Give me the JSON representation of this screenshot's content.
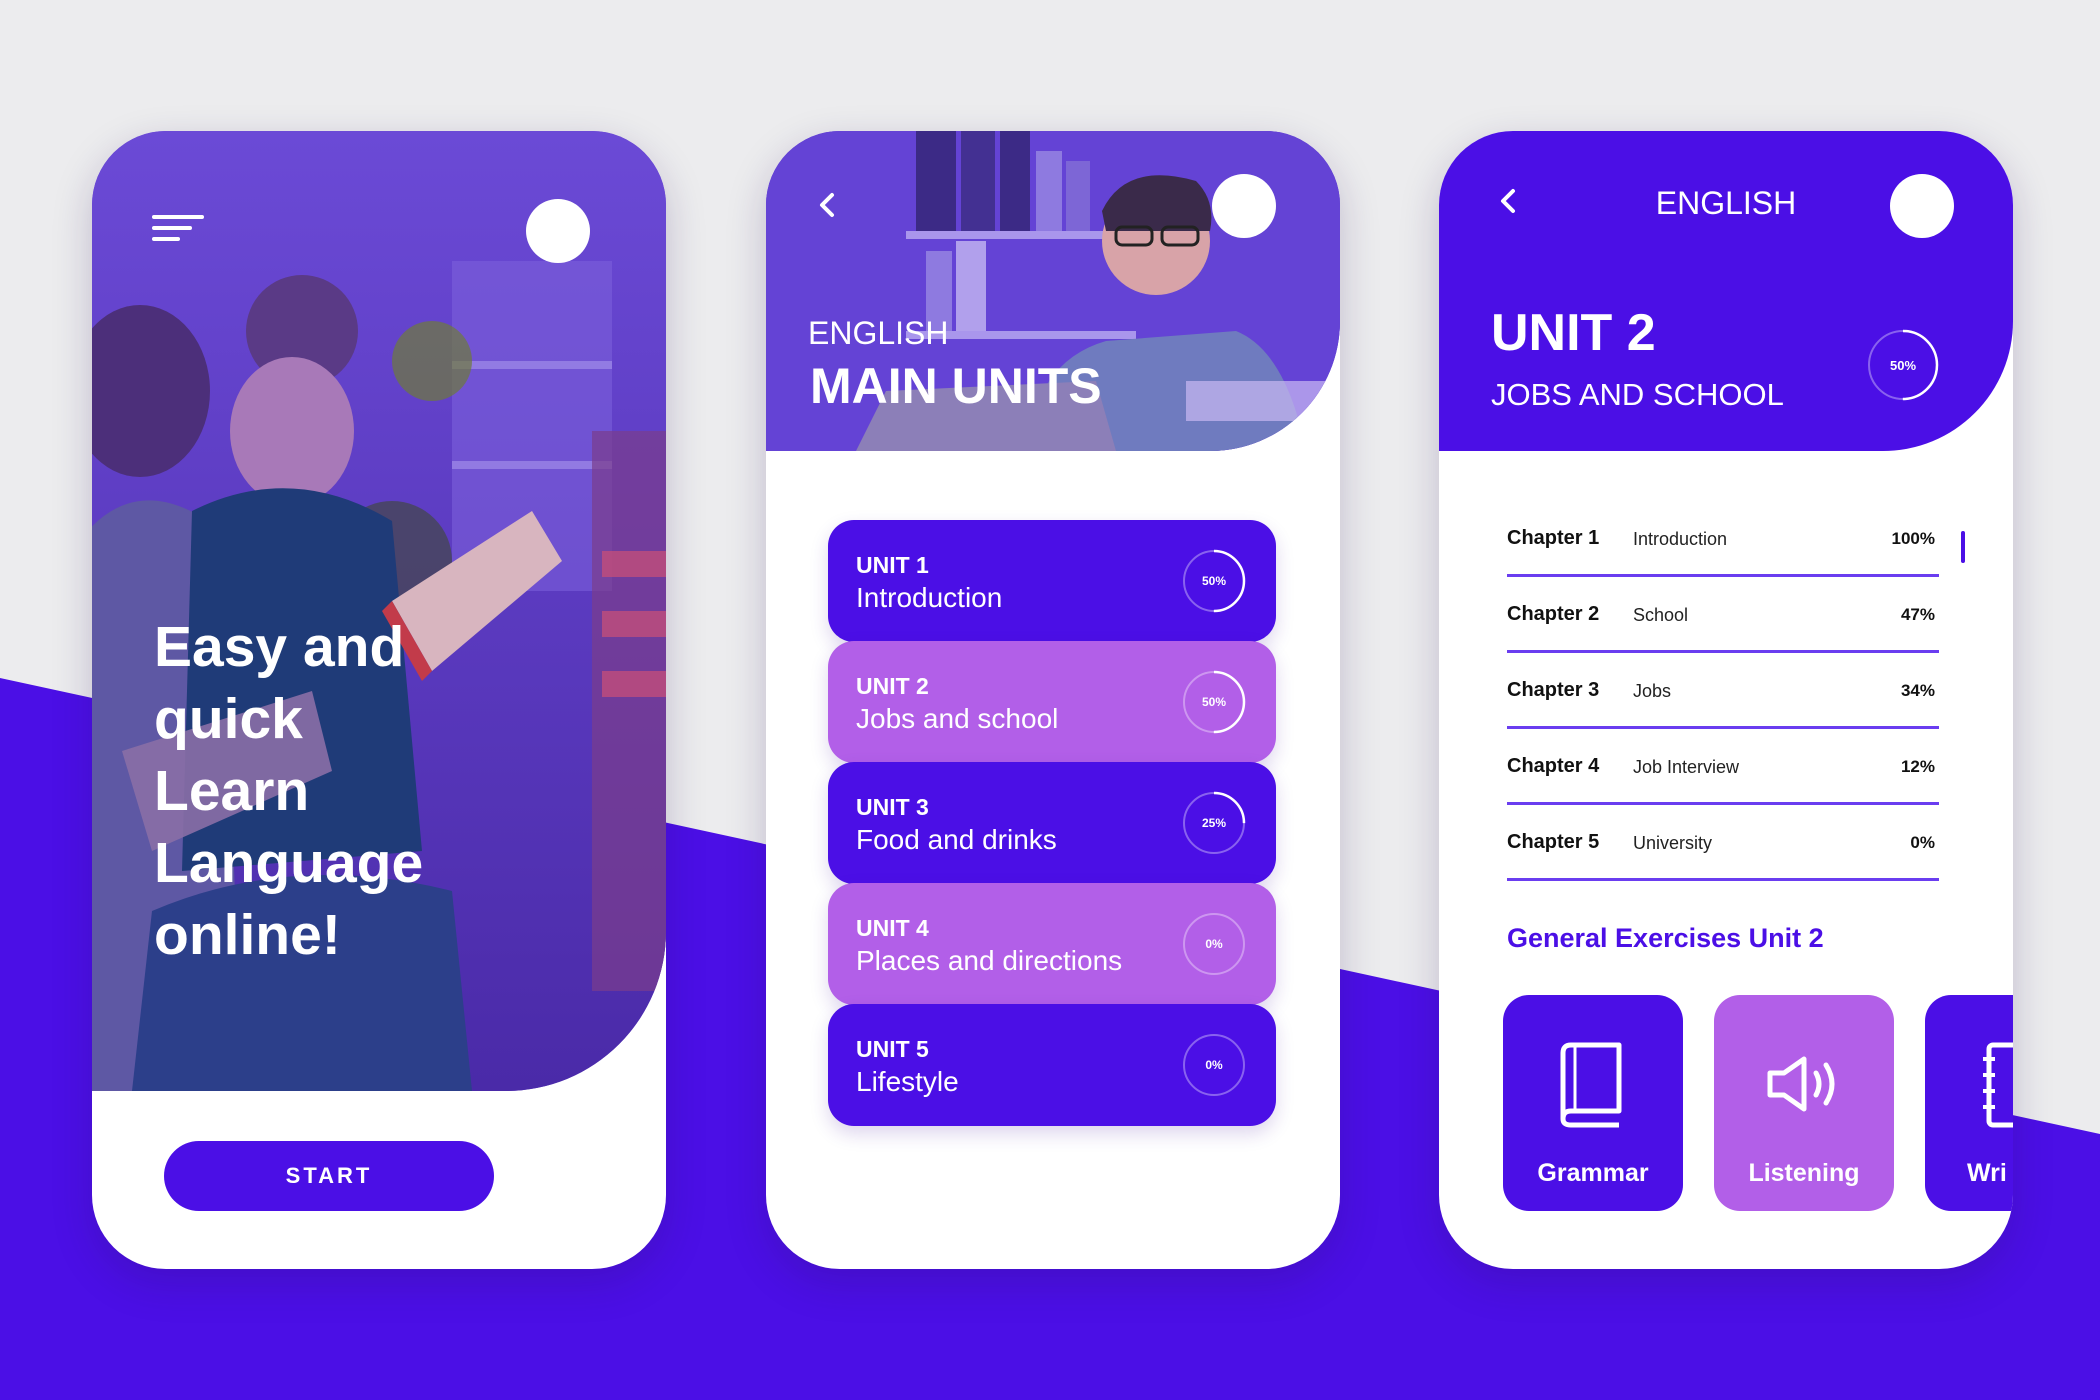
{
  "colors": {
    "primary": "#4b0fe6",
    "secondary": "#b25fe8",
    "background": "#ececee",
    "text_dark": "#111111"
  },
  "onboarding": {
    "menu_icon": "hamburger-menu-icon",
    "headline_lines": [
      "Easy and",
      "quick",
      "Learn",
      "Language",
      "online!"
    ],
    "start_label": "START"
  },
  "units_screen": {
    "back_icon": "chevron-left-icon",
    "kicker": "ENGLISH",
    "title": "MAIN UNITS",
    "units": [
      {
        "number": "UNIT 1",
        "name": "Introduction",
        "progress_label": "50%",
        "progress": 0.5,
        "style": "dark"
      },
      {
        "number": "UNIT 2",
        "name": "Jobs and school",
        "progress_label": "50%",
        "progress": 0.5,
        "style": "light"
      },
      {
        "number": "UNIT 3",
        "name": "Food and drinks",
        "progress_label": "25%",
        "progress": 0.25,
        "style": "dark"
      },
      {
        "number": "UNIT 4",
        "name": "Places and directions",
        "progress_label": "0%",
        "progress": 0,
        "style": "light"
      },
      {
        "number": "UNIT 5",
        "name": "Lifestyle",
        "progress_label": "0%",
        "progress": 0,
        "style": "dark"
      }
    ]
  },
  "detail_screen": {
    "back_icon": "chevron-left-icon",
    "top_title": "ENGLISH",
    "unit_title": "UNIT 2",
    "unit_subtitle": "JOBS AND SCHOOL",
    "progress_label": "50%",
    "progress": 0.5,
    "chapters": [
      {
        "title": "Chapter 1",
        "topic": "Introduction",
        "percent": "100%"
      },
      {
        "title": "Chapter 2",
        "topic": "School",
        "percent": "47%"
      },
      {
        "title": "Chapter 3",
        "topic": "Jobs",
        "percent": "34%"
      },
      {
        "title": "Chapter 4",
        "topic": "Job Interview",
        "percent": "12%"
      },
      {
        "title": "Chapter 5",
        "topic": "University",
        "percent": "0%"
      }
    ],
    "exercises_title": "General Exercises Unit 2",
    "exercises": [
      {
        "label": "Grammar",
        "icon": "book-icon",
        "style": "dark"
      },
      {
        "label": "Listening",
        "icon": "speaker-icon",
        "style": "light"
      },
      {
        "label": "Wri",
        "icon": "notebook-icon",
        "style": "dark"
      }
    ]
  }
}
